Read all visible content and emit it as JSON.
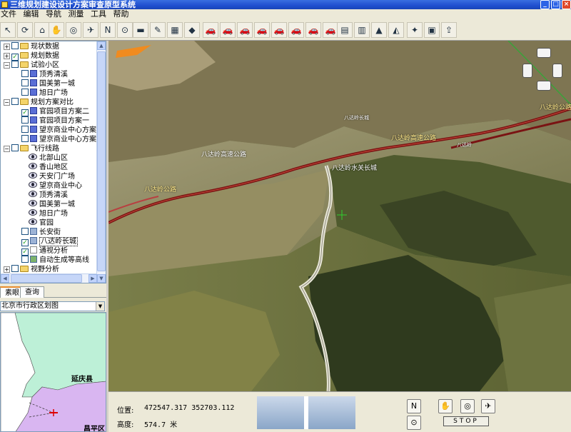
{
  "window": {
    "title": "三维规划建设设计方案审查原型系统"
  },
  "menu": [
    "文件",
    "编辑",
    "导航",
    "测量",
    "工具",
    "帮助"
  ],
  "toolbar_icons": [
    "cursor-icon",
    "refresh-icon",
    "home-icon",
    "pan-hand-icon",
    "orbit-icon",
    "fly-icon",
    "north-icon",
    "target-icon",
    "ruler-icon",
    "pencil-icon",
    "grid-icon",
    "measure-icon",
    "car1-icon",
    "car2-icon",
    "car3-icon",
    "car4-icon",
    "car5-icon",
    "car6-icon",
    "car7-icon",
    "car8-icon",
    "layer-chart-icon",
    "bar-chart-icon",
    "terrain-icon",
    "landscape-icon",
    "flyover-icon",
    "building-icon",
    "export-icon"
  ],
  "tree": {
    "items": [
      {
        "level": 0,
        "label": "现状数据",
        "checked": false,
        "icon": "folder"
      },
      {
        "level": 0,
        "label": "规划数据",
        "checked": true,
        "icon": "folder"
      },
      {
        "level": 0,
        "label": "试验小区",
        "checked": false,
        "icon": "folder",
        "expanded": true
      },
      {
        "level": 1,
        "label": "顶秀清溪",
        "checked": false,
        "icon": "cube"
      },
      {
        "level": 1,
        "label": "国美第一城",
        "checked": false,
        "icon": "cube"
      },
      {
        "level": 1,
        "label": "旭日广场",
        "checked": false,
        "icon": "cube"
      },
      {
        "level": 0,
        "label": "规划方案对比",
        "checked": false,
        "icon": "folder",
        "expanded": true
      },
      {
        "level": 1,
        "label": "官园项目方案二",
        "checked": true,
        "icon": "cube"
      },
      {
        "level": 1,
        "label": "官园项目方案一",
        "checked": false,
        "icon": "cube"
      },
      {
        "level": 1,
        "label": "望京商业中心方案二",
        "checked": false,
        "icon": "cube"
      },
      {
        "level": 1,
        "label": "望京商业中心方案一",
        "checked": false,
        "icon": "cube"
      },
      {
        "level": 0,
        "label": "飞行线路",
        "checked": false,
        "icon": "folder",
        "expanded": true
      },
      {
        "level": 1,
        "label": "北部山区",
        "icon": "eye"
      },
      {
        "level": 1,
        "label": "香山地区",
        "icon": "eye"
      },
      {
        "level": 1,
        "label": "天安门广场",
        "icon": "eye"
      },
      {
        "level": 1,
        "label": "望京商业中心",
        "icon": "eye"
      },
      {
        "level": 1,
        "label": "顶秀清溪",
        "icon": "eye"
      },
      {
        "level": 1,
        "label": "国美第一城",
        "icon": "eye"
      },
      {
        "level": 1,
        "label": "旭日广场",
        "icon": "eye"
      },
      {
        "level": 1,
        "label": "官园",
        "icon": "eye"
      },
      {
        "level": 1,
        "label": "长安街",
        "checked": false,
        "icon": "obj"
      },
      {
        "level": 1,
        "label": "八达岭长城",
        "checked": true,
        "icon": "obj",
        "selected": true
      },
      {
        "level": 1,
        "label": "通视分析",
        "checked": true,
        "icon": "line"
      },
      {
        "level": 1,
        "label": "自动生成等高线",
        "checked": false,
        "icon": "obj"
      },
      {
        "level": 0,
        "label": "视野分析",
        "checked": false,
        "icon": "folder"
      }
    ]
  },
  "tabs": {
    "source": "素眼",
    "query": "查询"
  },
  "map2d": {
    "select_value": "北京市行政区划图",
    "labels": {
      "yanqing": "延庆县",
      "changping": "昌平区"
    },
    "colors": {
      "yanqing": "#bdf0d7",
      "changping": "#d9b6f1",
      "other": "#ffffff"
    }
  },
  "view3d": {
    "places": [
      {
        "text": "八达岭公路",
        "style": "yel"
      },
      {
        "text": "八达岭高速公路",
        "style": "yel"
      },
      {
        "text": "八达岭水关长城",
        "style": "white"
      },
      {
        "text": "八达岭高速公路",
        "style": "white"
      },
      {
        "text": "八达岭公路",
        "style": "yel"
      },
      {
        "text": "八达岭长城",
        "style": "white"
      },
      {
        "text": "八达岭",
        "style": "white"
      }
    ]
  },
  "status": {
    "position_label": "位置:",
    "position_value": "472547.317  352703.112",
    "height_label": "高度:",
    "height_value": "574.7 米",
    "stop_label": "STOP"
  }
}
